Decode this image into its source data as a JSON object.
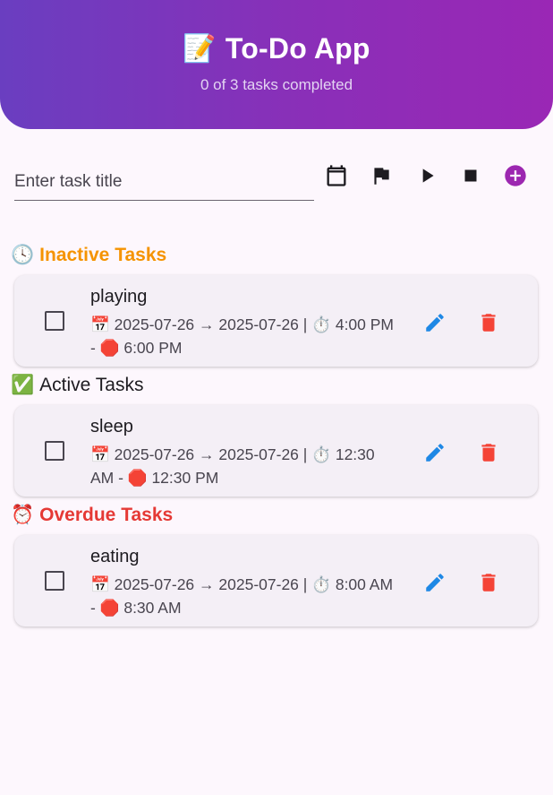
{
  "header": {
    "icon": "📝",
    "title": "To-Do App",
    "subtitle": "0 of 3 tasks completed"
  },
  "input": {
    "placeholder": "Enter task title",
    "value": ""
  },
  "toolbar": {
    "buttons": [
      "calendar-icon",
      "flag-icon",
      "play-icon",
      "stop-icon",
      "add-circle-icon"
    ]
  },
  "colors": {
    "header_start": "#6a3ec0",
    "header_end": "#9a27b5",
    "inactive": "#f59300",
    "active": "#1d1b20",
    "overdue": "#e53935",
    "edit": "#1e88e5",
    "delete": "#f44336",
    "add": "#9c27b0"
  },
  "sections": [
    {
      "icon": "🕓",
      "title": "Inactive Tasks",
      "tasks": [
        {
          "title": "playing",
          "meta_line1": "📅 2025-07-26 → 2025-07-26 | ⏱️ 4:00 PM",
          "meta_line2": "- 🛑 6:00 PM",
          "completed": false
        }
      ]
    },
    {
      "icon": "✅",
      "title": "Active Tasks",
      "tasks": [
        {
          "title": "sleep",
          "meta_line1": "📅 2025-07-26 → 2025-07-26 | ⏱️ 12:30",
          "meta_line2": "AM - 🛑 12:30 PM",
          "completed": false
        }
      ]
    },
    {
      "icon": "⏰",
      "title": "Overdue Tasks",
      "tasks": [
        {
          "title": "eating",
          "meta_line1": "📅 2025-07-26 → 2025-07-26 | ⏱️ 8:00 AM",
          "meta_line2": "- 🛑 8:30 AM",
          "completed": false
        }
      ]
    }
  ]
}
